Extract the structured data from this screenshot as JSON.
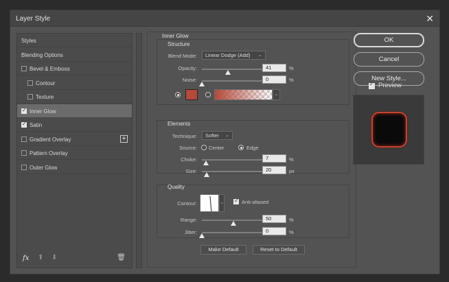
{
  "window": {
    "title": "Layer Style",
    "close_symbol": "✕"
  },
  "styles_list": {
    "items": [
      {
        "label": "Styles",
        "has_checkbox": false,
        "checked": false,
        "indent": false,
        "selected": false
      },
      {
        "label": "Blending Options",
        "has_checkbox": false,
        "checked": false,
        "indent": false,
        "selected": false
      },
      {
        "label": "Bevel & Emboss",
        "has_checkbox": true,
        "checked": false,
        "indent": false,
        "selected": false
      },
      {
        "label": "Contour",
        "has_checkbox": true,
        "checked": false,
        "indent": true,
        "selected": false
      },
      {
        "label": "Texture",
        "has_checkbox": true,
        "checked": false,
        "indent": true,
        "selected": false
      },
      {
        "label": "Inner Glow",
        "has_checkbox": true,
        "checked": true,
        "indent": false,
        "selected": true
      },
      {
        "label": "Satin",
        "has_checkbox": true,
        "checked": true,
        "indent": false,
        "selected": false
      },
      {
        "label": "Gradient Overlay",
        "has_checkbox": true,
        "checked": false,
        "indent": false,
        "selected": false,
        "has_add": true
      },
      {
        "label": "Pattern Overlay",
        "has_checkbox": true,
        "checked": false,
        "indent": false,
        "selected": false
      },
      {
        "label": "Outer Glow",
        "has_checkbox": true,
        "checked": false,
        "indent": false,
        "selected": false
      }
    ],
    "add_symbol": "+",
    "footer": {
      "fx": "fx",
      "up": "⬆",
      "down": "⬇",
      "trash": "🗑"
    }
  },
  "inner_glow": {
    "title": "Inner Glow",
    "structure": {
      "title": "Structure",
      "blend_mode_label": "Blend Mode:",
      "blend_mode": "Linear Dodge (Add)",
      "opacity_label": "Opacity:",
      "opacity": "41",
      "opacity_unit": "%",
      "opacity_level": 0.41,
      "noise_label": "Noise:",
      "noise": "0",
      "noise_unit": "%",
      "noise_level": 0,
      "glow_color": "#b34a3a"
    },
    "elements": {
      "title": "Elements",
      "technique_label": "Technique:",
      "technique": "Softer",
      "source_label": "Source:",
      "source_center": "Center",
      "source_edge": "Edge",
      "source_selected": "Edge",
      "choke_label": "Choke:",
      "choke": "7",
      "choke_unit": "%",
      "choke_level": 0.07,
      "size_label": "Size:",
      "size": "20",
      "size_unit": "px",
      "size_level": 0.08
    },
    "quality": {
      "title": "Quality",
      "contour_label": "Contour:",
      "anti_aliased_label": "Anti-aliased",
      "anti_aliased": true,
      "range_label": "Range:",
      "range": "50",
      "range_unit": "%",
      "range_level": 0.5,
      "jitter_label": "Jitter:",
      "jitter": "0",
      "jitter_unit": "%",
      "jitter_level": 0
    },
    "make_default": "Make Default",
    "reset_default": "Reset to Default"
  },
  "actions": {
    "ok": "OK",
    "cancel": "Cancel",
    "new_style": "New Style...",
    "preview_label": "Preview",
    "preview_checked": true
  },
  "caret": "⌄"
}
